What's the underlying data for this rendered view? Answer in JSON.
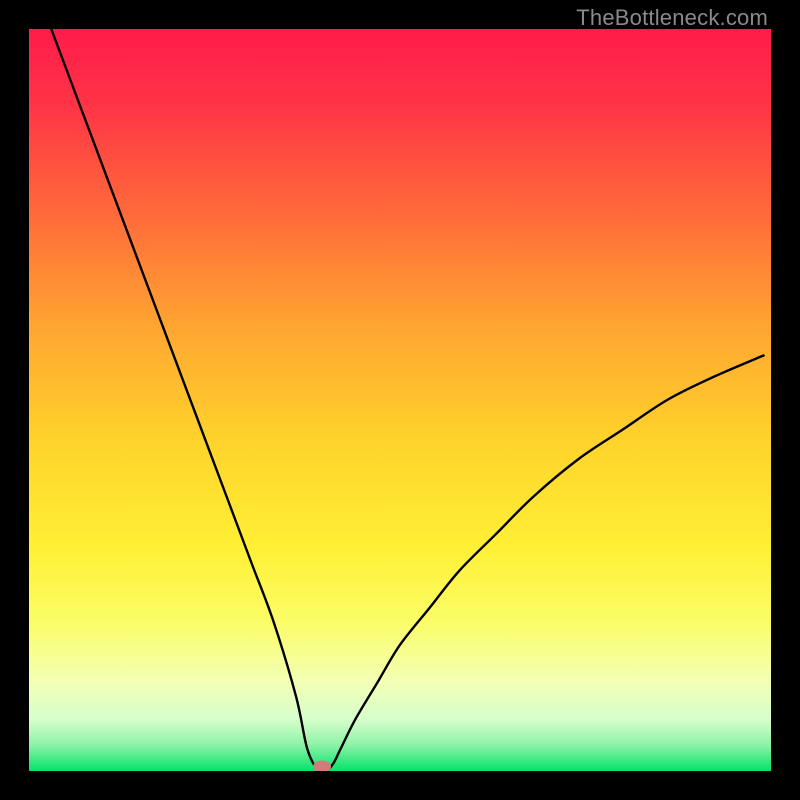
{
  "watermark": "TheBottleneck.com",
  "chart_data": {
    "type": "line",
    "title": "",
    "xlabel": "",
    "ylabel": "",
    "xlim": [
      0,
      100
    ],
    "ylim": [
      0,
      100
    ],
    "grid": false,
    "legend": false,
    "annotations": [],
    "series": [
      {
        "name": "bottleneck-curve",
        "x": [
          3,
          6,
          9,
          12,
          15,
          18,
          21,
          24,
          27,
          30,
          33,
          36,
          37.5,
          39,
          40,
          41,
          42,
          44,
          47,
          50,
          54,
          58,
          63,
          68,
          74,
          80,
          86,
          92,
          99
        ],
        "values": [
          100,
          92,
          84,
          76,
          68,
          60,
          52,
          44,
          36,
          28,
          20,
          10,
          3,
          0,
          0,
          1,
          3,
          7,
          12,
          17,
          22,
          27,
          32,
          37,
          42,
          46,
          50,
          53,
          56
        ]
      }
    ],
    "marker": {
      "x": 39.5,
      "y": 0.6,
      "color": "#cf7d7b",
      "rx": 9,
      "ry": 6
    },
    "gradient_stops": [
      {
        "offset": 0.0,
        "color": "#ff1b4a"
      },
      {
        "offset": 0.1,
        "color": "#ff3346"
      },
      {
        "offset": 0.25,
        "color": "#ff6a3a"
      },
      {
        "offset": 0.4,
        "color": "#ffa531"
      },
      {
        "offset": 0.55,
        "color": "#ffd22b"
      },
      {
        "offset": 0.7,
        "color": "#fff035"
      },
      {
        "offset": 0.8,
        "color": "#fbfd68"
      },
      {
        "offset": 0.88,
        "color": "#f3ffb5"
      },
      {
        "offset": 0.93,
        "color": "#d7ffcc"
      },
      {
        "offset": 0.965,
        "color": "#8df3a6"
      },
      {
        "offset": 1.0,
        "color": "#04e36a"
      }
    ]
  }
}
